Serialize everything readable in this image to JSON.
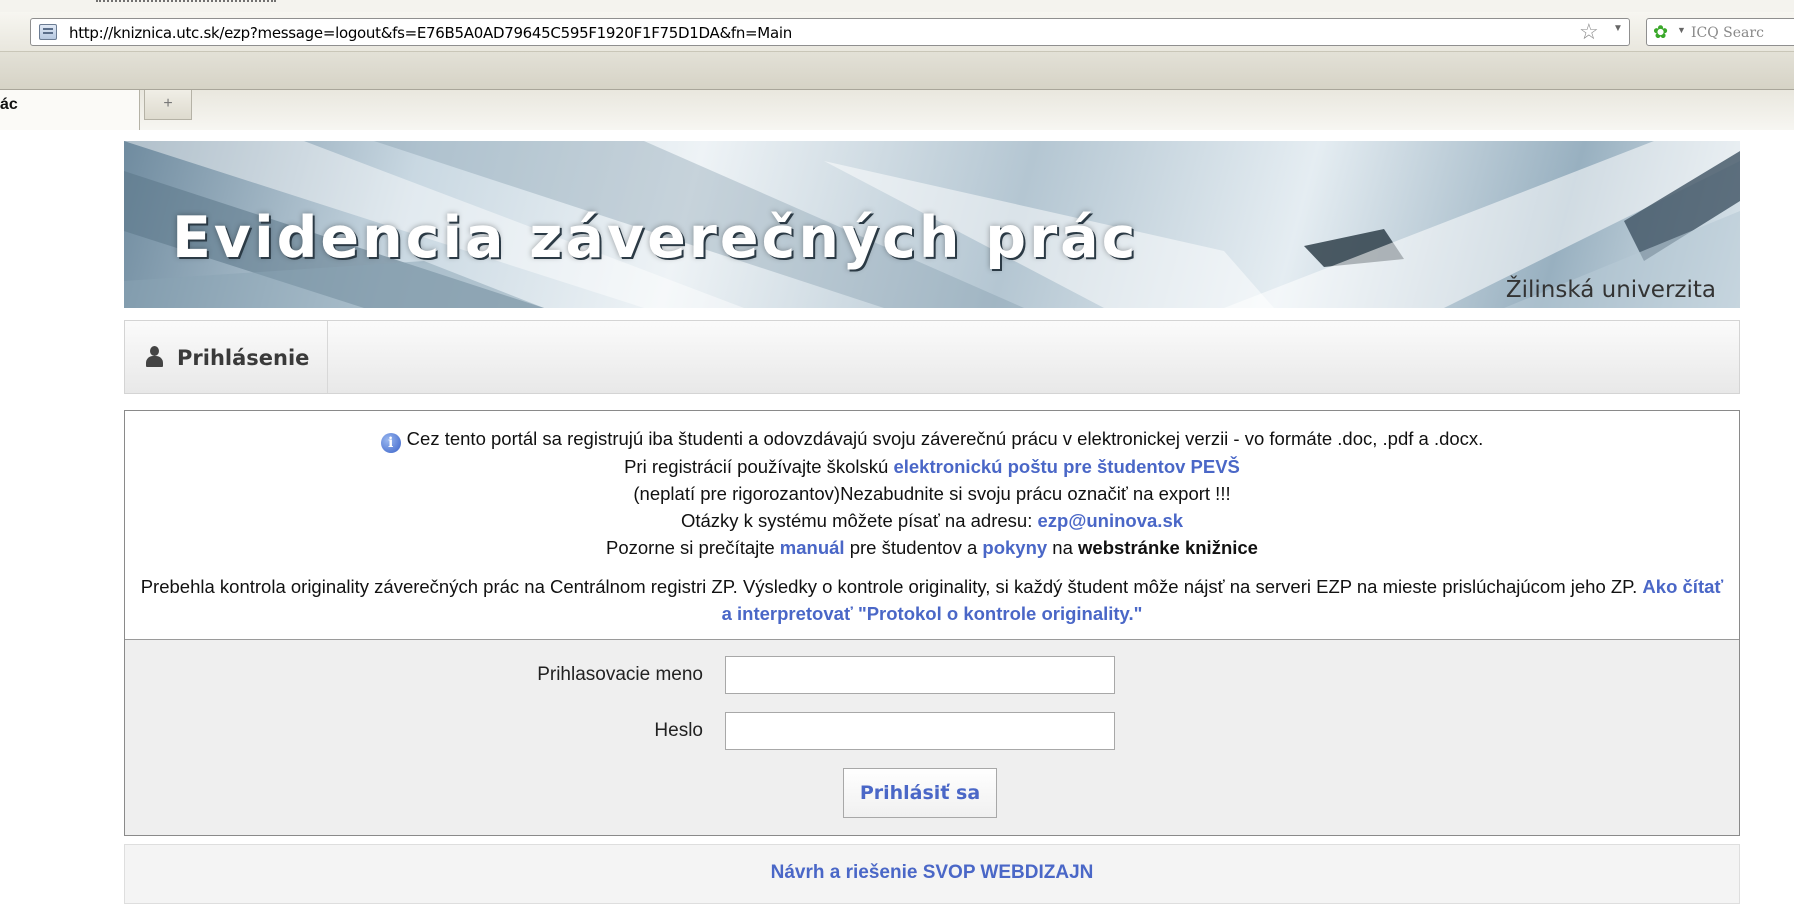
{
  "browser": {
    "url": "http://kniznica.utc.sk/ezp?message=logout&fs=E76B5A0AD79645C595F1920F1F75D1DA&fn=Main",
    "search_engine_label": "ICQ Searc",
    "active_tab_label": "ác",
    "new_tab_symbol": "+"
  },
  "banner": {
    "title": "Evidencia záverečných prác",
    "university": "Žilinská univerzita"
  },
  "menu": {
    "items": [
      {
        "label": "Prihlásenie"
      }
    ]
  },
  "info": {
    "l1": "Cez tento portál sa registrujú iba študenti a odovzdávajú svoju záverečnú prácu v elektronickej verzii - vo formáte .doc, .pdf a .docx.",
    "l2_a": "Pri registrácií používajte školskú ",
    "l2_link": "elektronickú poštu pre študentov PEVŠ",
    "l3": "(neplatí pre rigorozantov)Nezabudnite si svoju prácu označiť na export !!!",
    "l4_a": "Otázky k systému môžete písať na adresu: ",
    "l4_link": "ezp@uninova.sk",
    "l5_a": "Pozorne si prečítajte ",
    "l5_link1": "manuál",
    "l5_b": " pre študentov a ",
    "l5_link2": "pokyny",
    "l5_c": " na ",
    "l5_bold": "webstránke knižnice",
    "l6": "Prebehla kontrola originality záverečných prác na Centrálnom registri ZP. Výsledky o kontrole originality, si každý študent môže nájsť na serveri EZP na mieste prislúchajúcom jeho ZP. ",
    "l6_link": "Ako čítať a interpretovať \"Protokol o kontrole originality.\""
  },
  "login": {
    "username_label": "Prihlasovacie meno",
    "username_value": "",
    "password_label": "Heslo",
    "password_value": "",
    "submit_label": "Prihlásiť sa"
  },
  "footer": {
    "credit": "Návrh a riešenie SVOP WEBDIZAJN"
  },
  "colors": {
    "link": "#4a67c7",
    "login_bg": "#efefef",
    "border": "#8a8a8a"
  },
  "icons": [
    "site-identity-icon",
    "bookmark-star-icon",
    "dropdown-arrow-icon",
    "icq-flower-icon",
    "user-icon",
    "info-icon"
  ]
}
